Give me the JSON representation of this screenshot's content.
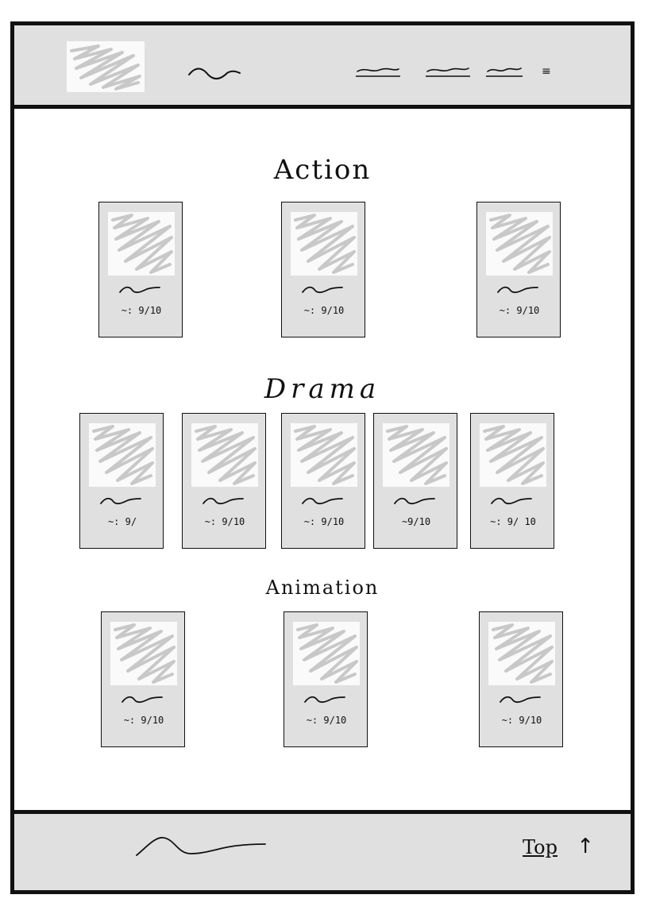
{
  "header": {
    "logo_icon": "logo-placeholder-icon",
    "nav_items": [
      "",
      "",
      ""
    ],
    "menu_icon": "≡"
  },
  "sections": [
    {
      "title": "Action",
      "cards": [
        {
          "rating": "~: 9/10"
        },
        {
          "rating": "~: 9/10"
        },
        {
          "rating": "~: 9/10"
        }
      ]
    },
    {
      "title": "Drama",
      "cards": [
        {
          "rating": "~: 9/"
        },
        {
          "rating": "~: 9/10"
        },
        {
          "rating": "~: 9/10"
        },
        {
          "rating": "~9/10"
        },
        {
          "rating": "~: 9/ 10"
        }
      ]
    },
    {
      "title": "Animation",
      "cards": [
        {
          "rating": "~: 9/10"
        },
        {
          "rating": "~: 9/10"
        },
        {
          "rating": "~: 9/10"
        }
      ]
    }
  ],
  "footer": {
    "top_label": "Top",
    "top_arrow": "↑"
  },
  "colors": {
    "panel": "#e0e0e0",
    "border": "#111111",
    "placeholder": "#fafafa",
    "scribble": "#c8c8c8"
  }
}
